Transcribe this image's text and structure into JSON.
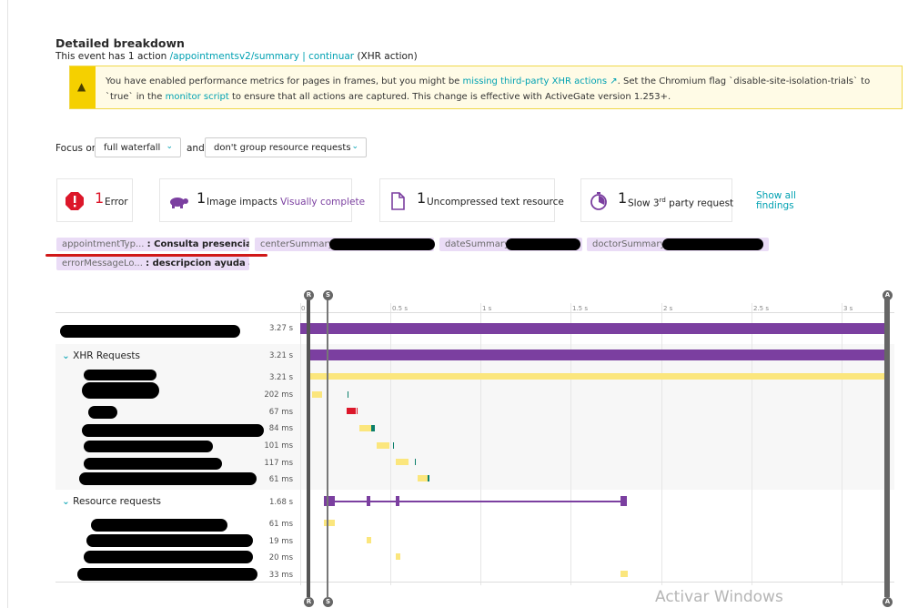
{
  "header": {
    "title": "Detailed breakdown",
    "subtitle_prefix": "This event has 1 action ",
    "action_link": "/appointmentsv2/summary | continuar",
    "subtitle_suffix": " (XHR action)"
  },
  "warning": {
    "icon": "warning-icon",
    "text_1": "You have enabled performance metrics for pages in frames, but you might be ",
    "link_1": "missing third-party XHR actions",
    "text_2": ". Set the Chromium flag `disable-site-isolation-trials` to `true` in the ",
    "link_2": "monitor script",
    "text_3": " to ensure that all actions are captured. This change is effective with ActiveGate version 1.253+."
  },
  "filters": {
    "focus_label": "Focus on",
    "focus_value": "full waterfall",
    "and_label": "and",
    "group_value": "don't group resource requests"
  },
  "findings": [
    {
      "count": "1",
      "label": "Error",
      "link": "",
      "icon": "error-icon"
    },
    {
      "count": "1",
      "label": "Image impacts ",
      "link": "Visually complete",
      "icon": "turtle-icon"
    },
    {
      "count": "1",
      "label": "Uncompressed text resource",
      "link": "",
      "icon": "document-icon"
    },
    {
      "count": "1",
      "label": "Slow 3",
      "sup": "rd",
      "label2": " party request",
      "icon": "timer-icon"
    }
  ],
  "show_all": "Show all findings",
  "chips": [
    {
      "key": "appointmentTyp...",
      "value": ": Consulta presencial..."
    },
    {
      "key": "centerSummary",
      "value": ""
    },
    {
      "key": "dateSummary",
      "value": ""
    },
    {
      "key": "doctorSummary",
      "value": ""
    },
    {
      "key": "errorMessageLo...",
      "value": ": descripcion ayuda a..."
    }
  ],
  "axis": {
    "ticks": [
      "0",
      "0.5 s",
      "1 s",
      "1.5 s",
      "2 s",
      "2.5 s",
      "3 s"
    ],
    "markers": {
      "r": "R",
      "s": "S",
      "a": "A"
    }
  },
  "waterfall": {
    "total_duration": "3.27 s",
    "xhr_group": {
      "label": "XHR Requests",
      "duration": "3.21 s"
    },
    "xhr_rows": [
      "3.21 s",
      "202 ms",
      "67 ms",
      "84 ms",
      "101 ms",
      "117 ms",
      "61 ms"
    ],
    "resource_group": {
      "label": "Resource requests",
      "duration": "1.68 s"
    },
    "resource_rows": [
      "61 ms",
      "19 ms",
      "20 ms",
      "33 ms"
    ]
  },
  "colors": {
    "accent": "#00a1b2",
    "purple": "#7b3fa0",
    "yellow": "#fbe67d",
    "error": "#dc172a",
    "teal": "#0b7f6b"
  },
  "watermark": "Activar Windows"
}
